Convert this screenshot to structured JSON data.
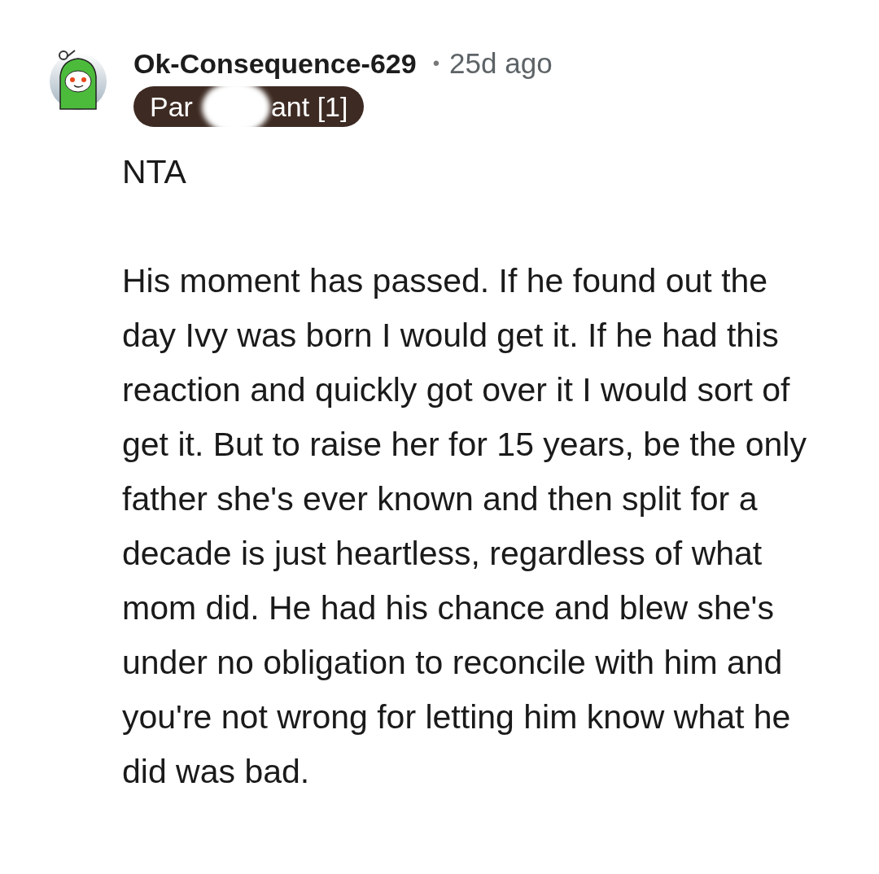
{
  "comment": {
    "username": "Ok-Consequence-629",
    "separator": "•",
    "time": "25d ago",
    "flair": {
      "before": "Par",
      "after": "ant [1]",
      "redacted": true
    },
    "paragraphs": [
      "NTA",
      "His moment has passed. If he found out the day Ivy was born I would get it. If he had this reaction and quickly got over it I would sort of get it. But to raise her for 15 years, be the only father she's ever known and then split for a decade is just heartless, regardless of what mom did. He had his chance and blew she's under no obligation to reconcile with him and you're not wrong for letting him know what he did was bad."
    ]
  }
}
